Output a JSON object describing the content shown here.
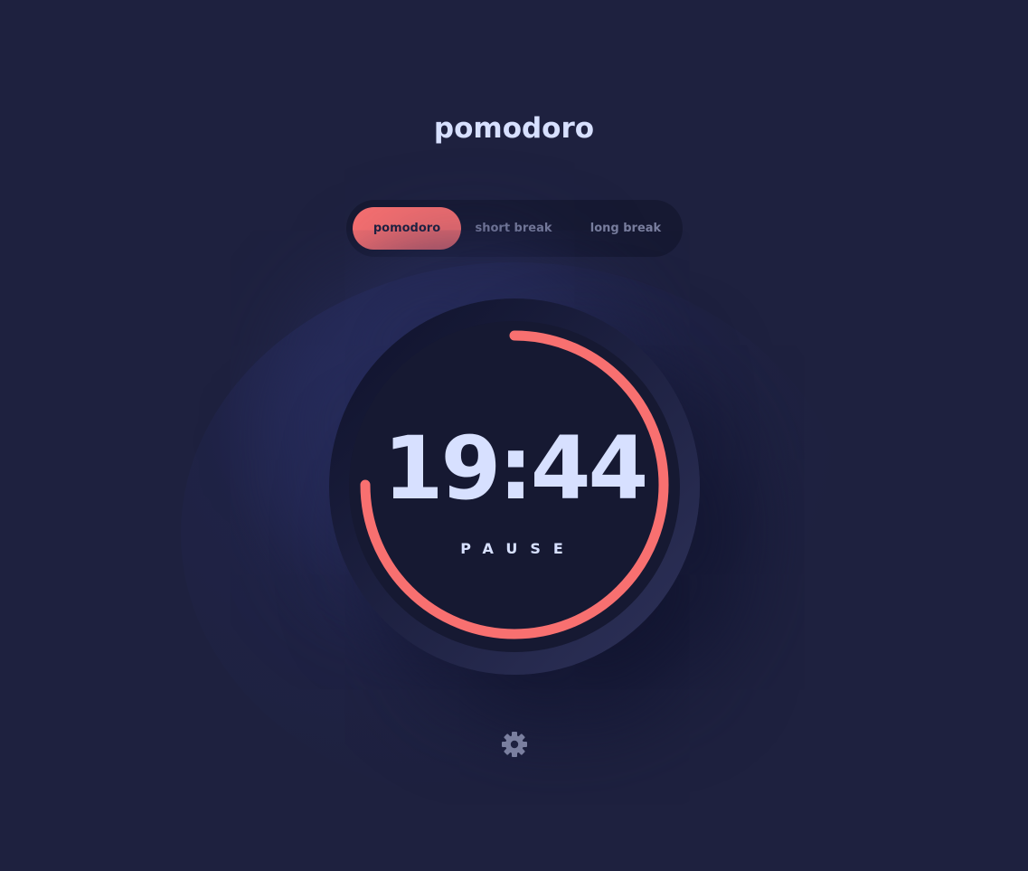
{
  "app": {
    "title": "pomodoro"
  },
  "modes": {
    "tabs": [
      {
        "label": "pomodoro",
        "active": true
      },
      {
        "label": "short break",
        "active": false
      },
      {
        "label": "long break",
        "active": false
      }
    ]
  },
  "timer": {
    "time": "19:44",
    "action_label": "PAUSE",
    "progress_fraction": 0.75
  },
  "settings": {
    "icon": "gear-icon"
  },
  "colors": {
    "background": "#1e213f",
    "accent": "#f87070",
    "text": "#d7e0ff",
    "muted_text": "#7a7f9f",
    "panel": "#161932"
  }
}
